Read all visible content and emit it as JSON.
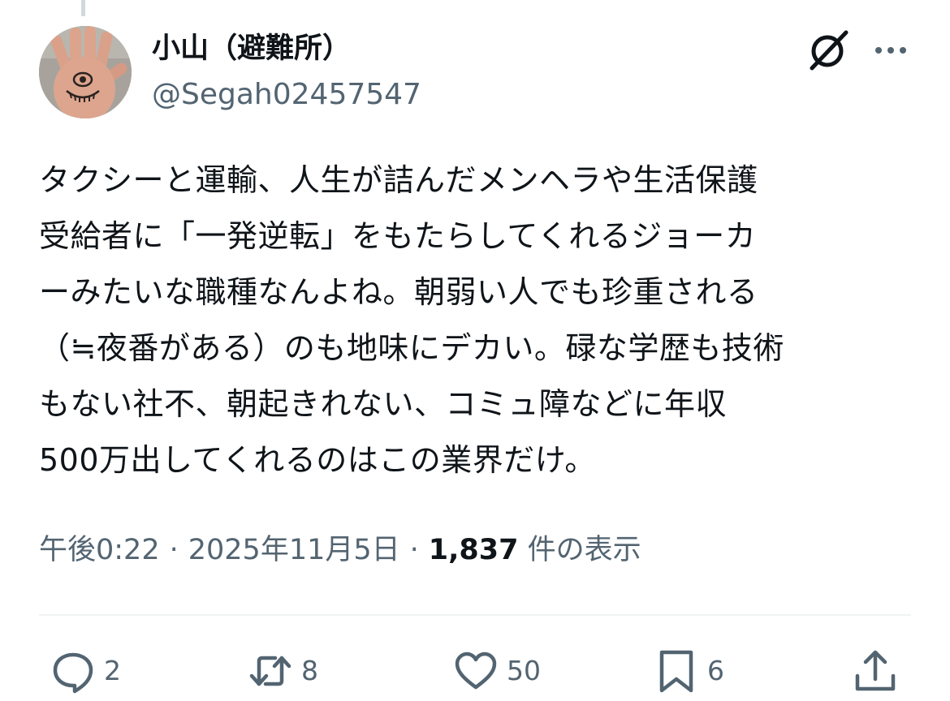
{
  "author": {
    "display_name": "小山（避難所）",
    "handle": "@Segah02457547"
  },
  "tweet": {
    "lines": [
      "タクシーと運輸、人生が詰んだメンヘラや生活保護",
      "受給者に「一発逆転」をもたらしてくれるジョーカ",
      "ーみたいな職種なんよね。朝弱い人でも珍重される",
      "（≒夜番がある）のも地味にデカい。碌な学歴も技術",
      "もない社不、朝起きれない、コミュ障などに年収",
      "500万出してくれるのはこの業界だけ。"
    ]
  },
  "meta": {
    "time": "午後0:22",
    "separator": "·",
    "date": "2025年11月5日",
    "views_count": "1,837",
    "views_label": "件の表示"
  },
  "actions": {
    "replies": "2",
    "reposts": "8",
    "likes": "50",
    "bookmarks": "6"
  },
  "icons": {
    "header": [
      "grok-icon",
      "more-icon"
    ],
    "actions": [
      "reply-icon",
      "repost-icon",
      "like-icon",
      "bookmark-icon",
      "share-icon"
    ]
  },
  "colors": {
    "text": "#0f1419",
    "secondary": "#536471",
    "divider": "#eff3f4"
  }
}
